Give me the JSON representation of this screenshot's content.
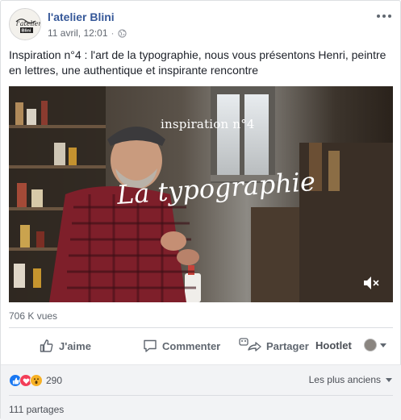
{
  "post": {
    "page_name": "l'atelier Blini",
    "timestamp": "11 avril, 12:01",
    "separator": "·",
    "caption": "Inspiration n°4 : l'art de la typographie, nous vous présentons Henri, peintre en lettres, une authentique et inspirante rencontre",
    "avatar_icon": "atelier-blini-logo",
    "privacy_icon": "globe-icon"
  },
  "video": {
    "subtitle": "inspiration n°4",
    "title": "La typographie",
    "views": "706 K vues",
    "mute_icon": "speaker-muted-icon"
  },
  "actions": {
    "like_label": "J'aime",
    "comment_label": "Commenter",
    "share_label": "Partager",
    "hootlet_label": "Hootlet"
  },
  "footer": {
    "reaction_icons": [
      "like",
      "love",
      "wow"
    ],
    "reaction_count": "290",
    "sort_label": "Les plus anciens",
    "shares_label": "111 partages"
  },
  "colors": {
    "link_blue": "#365899",
    "like_blue": "#1877f2",
    "love_red": "#f33e58",
    "wow_yellow": "#f7b125",
    "muted_text": "#606770"
  }
}
